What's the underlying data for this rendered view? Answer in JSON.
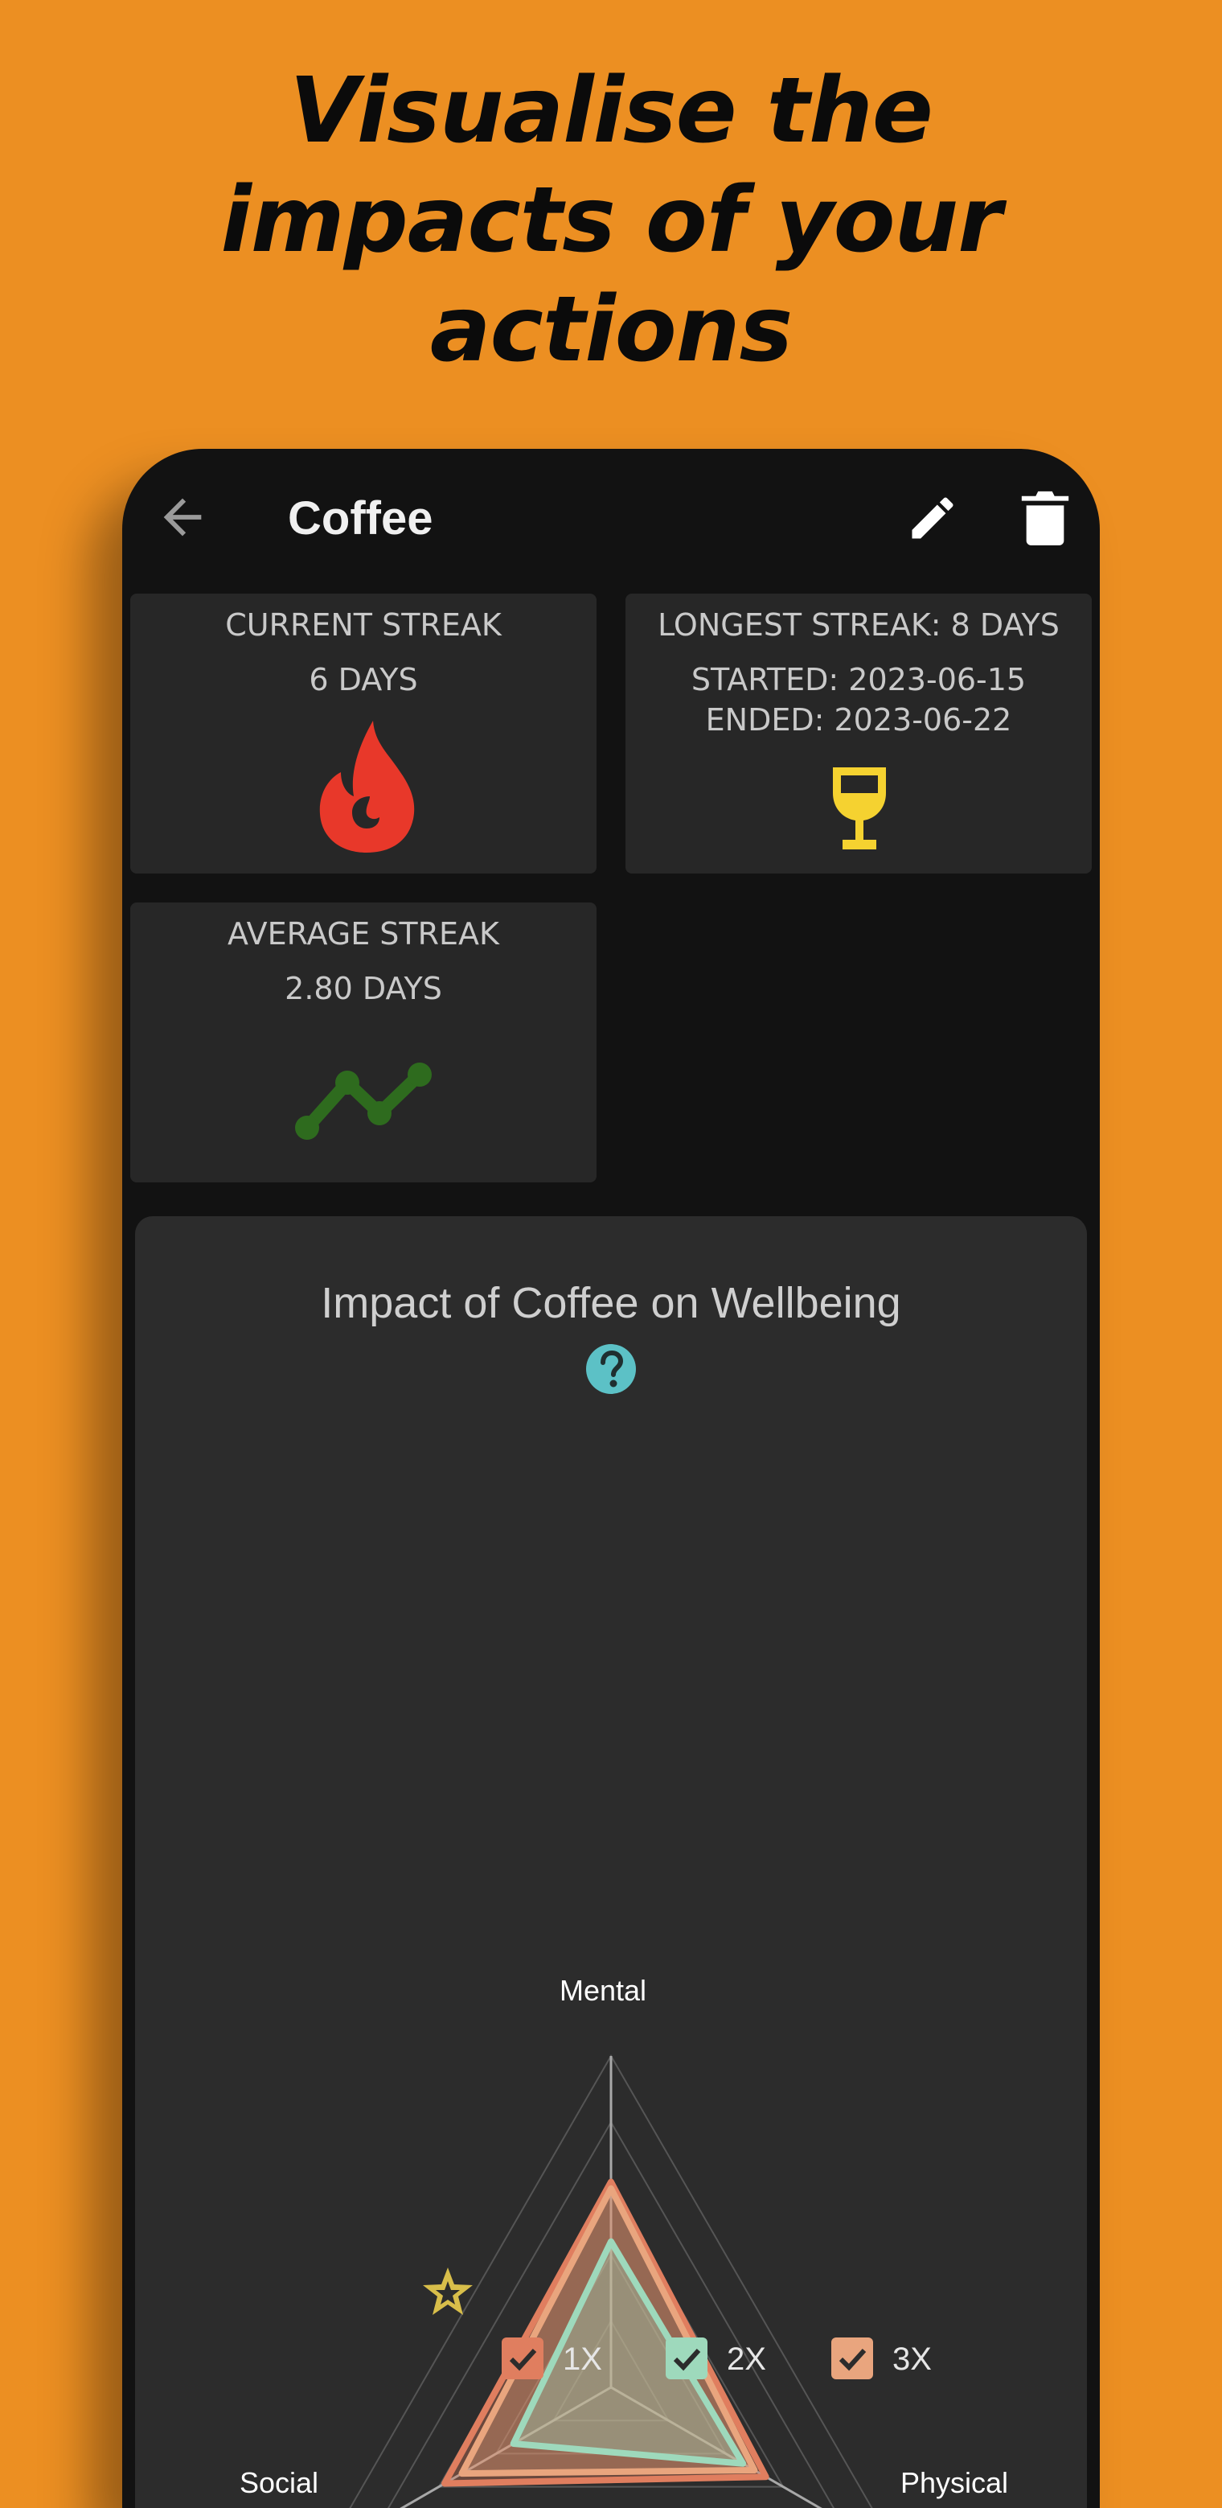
{
  "headline": {
    "line1": "Visualise the",
    "line2": "impacts of your",
    "line3": "actions"
  },
  "appbar": {
    "title": "Coffee",
    "back_icon": "arrow-back-icon",
    "edit_icon": "pencil-icon",
    "delete_icon": "trash-icon"
  },
  "cards": {
    "current": {
      "label": "CURRENT STREAK",
      "value": "6 DAYS",
      "icon": "fire-icon",
      "icon_color": "#E8382A"
    },
    "longest": {
      "label": "LONGEST STREAK: 8 DAYS",
      "started": "STARTED: 2023-06-15",
      "ended": "ENDED: 2023-06-22",
      "icon": "trophy-icon",
      "icon_color": "#F5D230"
    },
    "average": {
      "label": "AVERAGE STREAK",
      "value": "2.80 DAYS",
      "icon": "chart-line-icon",
      "icon_color": "#2E6B1E"
    }
  },
  "impact": {
    "title": "Impact of Coffee on Wellbeing",
    "help_icon": "help-circle-icon",
    "help_color": "#5CC1C6"
  },
  "chart_data": {
    "type": "radar",
    "axes": [
      "Mental",
      "Physical",
      "Social"
    ],
    "range": [
      0,
      5
    ],
    "grid_levels": 5,
    "series": [
      {
        "name": "1X",
        "values": [
          3.1,
          2.7,
          2.9
        ],
        "color": "#E07E5F",
        "checked": true
      },
      {
        "name": "2X",
        "values": [
          2.2,
          2.3,
          1.7
        ],
        "color": "#9ED9BC",
        "checked": true
      },
      {
        "name": "3X",
        "values": [
          3.0,
          2.5,
          2.6
        ],
        "color": "#E9A57E",
        "checked": true
      }
    ],
    "legend_icon": "star-icon",
    "legend_icon_color": "#D8BE4A"
  }
}
